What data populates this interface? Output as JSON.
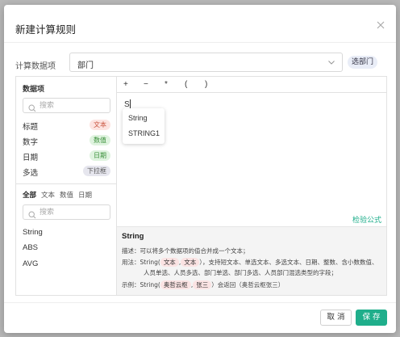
{
  "dialog": {
    "title": "新建计算规则",
    "close_icon": "close-icon"
  },
  "field": {
    "label": "计算数据项",
    "value": "部门",
    "tag": "选部门"
  },
  "left_panel": {
    "title": "数据项",
    "search_placeholder": "搜索",
    "items": [
      {
        "label": "标题",
        "badge": "文本",
        "badge_bg": "#fde4e1"
      },
      {
        "label": "数字",
        "badge": "数值",
        "badge_bg": "#dff3df"
      },
      {
        "label": "日期",
        "badge": "日期",
        "badge_bg": "#dff3df"
      },
      {
        "label": "多选",
        "badge": "下拉框",
        "badge_bg": "#e6e6ee"
      }
    ],
    "tabs": [
      "全部",
      "文本",
      "数值",
      "日期"
    ],
    "fn_search_placeholder": "搜索",
    "functions": [
      "String",
      "ABS",
      "AVG"
    ]
  },
  "editor": {
    "operators": [
      "+",
      "−",
      "*",
      "(",
      ")"
    ],
    "text": "S",
    "suggestions": [
      "String",
      "STRING1"
    ],
    "verify_label": "检验公式"
  },
  "help": {
    "title": "String",
    "desc_label": "描述：",
    "desc": "可以将多个数据项的值合并成一个文本；",
    "usage_label": "用法：",
    "usage_fn": "String(",
    "usage_chip1": "文本",
    "usage_chip2": "文本",
    "usage_rest": "），支持短文本、单选文本、多选文本、日期、整数、含小数数值、",
    "usage_line2": "人员单选、人员多选、部门单选、部门多选、人员部门混选类型的字段；",
    "example_label": "示例：",
    "example_fn": "String(",
    "example_chip1": "奥哲云枢",
    "example_chip2": "张三",
    "example_rest": "）会返回（奥哲云枢张三）"
  },
  "footer": {
    "cancel": "取 消",
    "save": "保 存"
  },
  "colors": {
    "accent": "#1fae8b"
  }
}
